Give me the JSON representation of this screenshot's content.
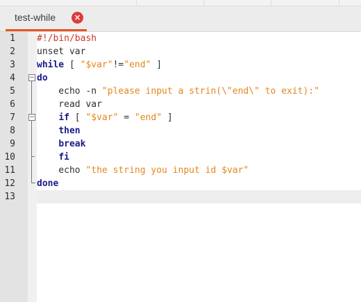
{
  "tab": {
    "title": "test-while",
    "close_symbol": "×",
    "accent": "#e95420",
    "close_color": "#de3b3b"
  },
  "editor": {
    "lines": [
      {
        "num": "1",
        "tokens": [
          {
            "t": "shebang",
            "v": "#!/bin/bash"
          }
        ]
      },
      {
        "num": "2",
        "tokens": [
          {
            "t": "plain",
            "v": "unset var"
          }
        ]
      },
      {
        "num": "3",
        "tokens": [
          {
            "t": "kw",
            "v": "while"
          },
          {
            "t": "plain",
            "v": " [ "
          },
          {
            "t": "str",
            "v": "\"$var\""
          },
          {
            "t": "plain",
            "v": "!="
          },
          {
            "t": "str",
            "v": "\"end\""
          },
          {
            "t": "plain",
            "v": " ]"
          }
        ]
      },
      {
        "num": "4",
        "tokens": [
          {
            "t": "kw",
            "v": "do"
          }
        ]
      },
      {
        "num": "5",
        "tokens": [
          {
            "t": "plain",
            "v": "    echo -n "
          },
          {
            "t": "str",
            "v": "\"please input a strin(\\\"end\\\" to exit):\""
          }
        ]
      },
      {
        "num": "6",
        "tokens": [
          {
            "t": "plain",
            "v": "    read var"
          }
        ]
      },
      {
        "num": "7",
        "tokens": [
          {
            "t": "plain",
            "v": "    "
          },
          {
            "t": "kw",
            "v": "if"
          },
          {
            "t": "plain",
            "v": " [ "
          },
          {
            "t": "str",
            "v": "\"$var\""
          },
          {
            "t": "plain",
            "v": " = "
          },
          {
            "t": "str",
            "v": "\"end\""
          },
          {
            "t": "plain",
            "v": " ]"
          }
        ]
      },
      {
        "num": "8",
        "tokens": [
          {
            "t": "plain",
            "v": "    "
          },
          {
            "t": "kw",
            "v": "then"
          }
        ]
      },
      {
        "num": "9",
        "tokens": [
          {
            "t": "plain",
            "v": "    "
          },
          {
            "t": "kw",
            "v": "break"
          }
        ]
      },
      {
        "num": "10",
        "tokens": [
          {
            "t": "plain",
            "v": "    "
          },
          {
            "t": "kw",
            "v": "fi"
          }
        ]
      },
      {
        "num": "11",
        "tokens": [
          {
            "t": "plain",
            "v": "    echo "
          },
          {
            "t": "str",
            "v": "\"the string you input id $var\""
          }
        ]
      },
      {
        "num": "12",
        "tokens": [
          {
            "t": "kw",
            "v": "done"
          }
        ]
      },
      {
        "num": "13",
        "tokens": []
      }
    ],
    "current_line": "13",
    "colors": {
      "keyword": "#1a1a8c",
      "string": "#e3871c",
      "shebang": "#c43a2b"
    }
  }
}
